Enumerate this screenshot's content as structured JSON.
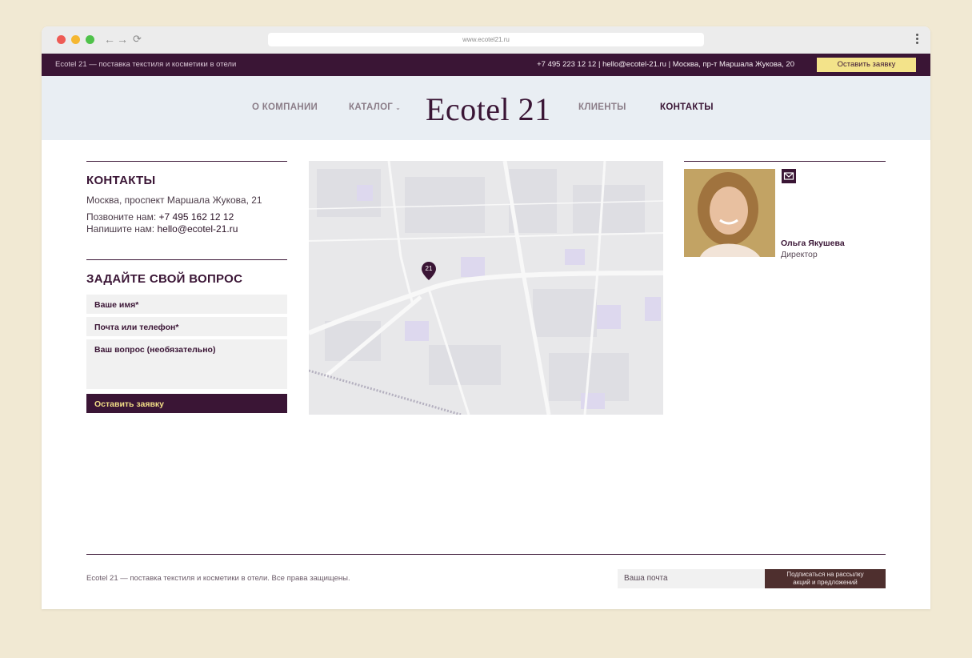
{
  "browser": {
    "url": "www.ecotel21.ru"
  },
  "topbar": {
    "tagline": "Ecotel 21 — поставка текстиля и косметики в отели",
    "contacts": "+7 495 223 12 12 | hello@ecotel-21.ru | Москва, пр-т Маршала Жукова, 20",
    "cta_label": "Оставить заявку"
  },
  "header": {
    "logo": "Ecotel 21",
    "menu": [
      {
        "label": "О КОМПАНИИ"
      },
      {
        "label": "КАТАЛОГ"
      },
      {
        "label": "КЛИЕНТЫ"
      },
      {
        "label": "КОНТАКТЫ"
      }
    ]
  },
  "contacts": {
    "title": "КОНТАКТЫ",
    "address": "Москва, проспект Маршала Жукова, 21",
    "call_prefix": "Позвоните нам: ",
    "phone": "+7 495 162 12 12",
    "write_prefix": "Напишите нам: ",
    "email": "hello@ecotel-21.ru"
  },
  "form": {
    "title": "ЗАДАЙТЕ СВОЙ ВОПРОС",
    "name_label": "Ваше имя*",
    "contact_label": "Почта или телефон*",
    "question_label": "Ваш вопрос (необязательно)",
    "submit_label": "Оставить заявку"
  },
  "map": {
    "marker_label": "21"
  },
  "person": {
    "name": "Ольга Якушева",
    "role": "Директор"
  },
  "footer": {
    "copyright": "Ecotel 21 — поставка текстиля и косметики в отели. Все права защищены.",
    "email_placeholder": "Ваша почта",
    "subscribe_line1": "Подписаться на рассылку",
    "subscribe_line2": "акций и предложений"
  },
  "colors": {
    "brand": "#3a1535",
    "accent_yellow": "#f3e38a",
    "background": "#f1e9d3",
    "header_bg": "#e9eef3"
  }
}
